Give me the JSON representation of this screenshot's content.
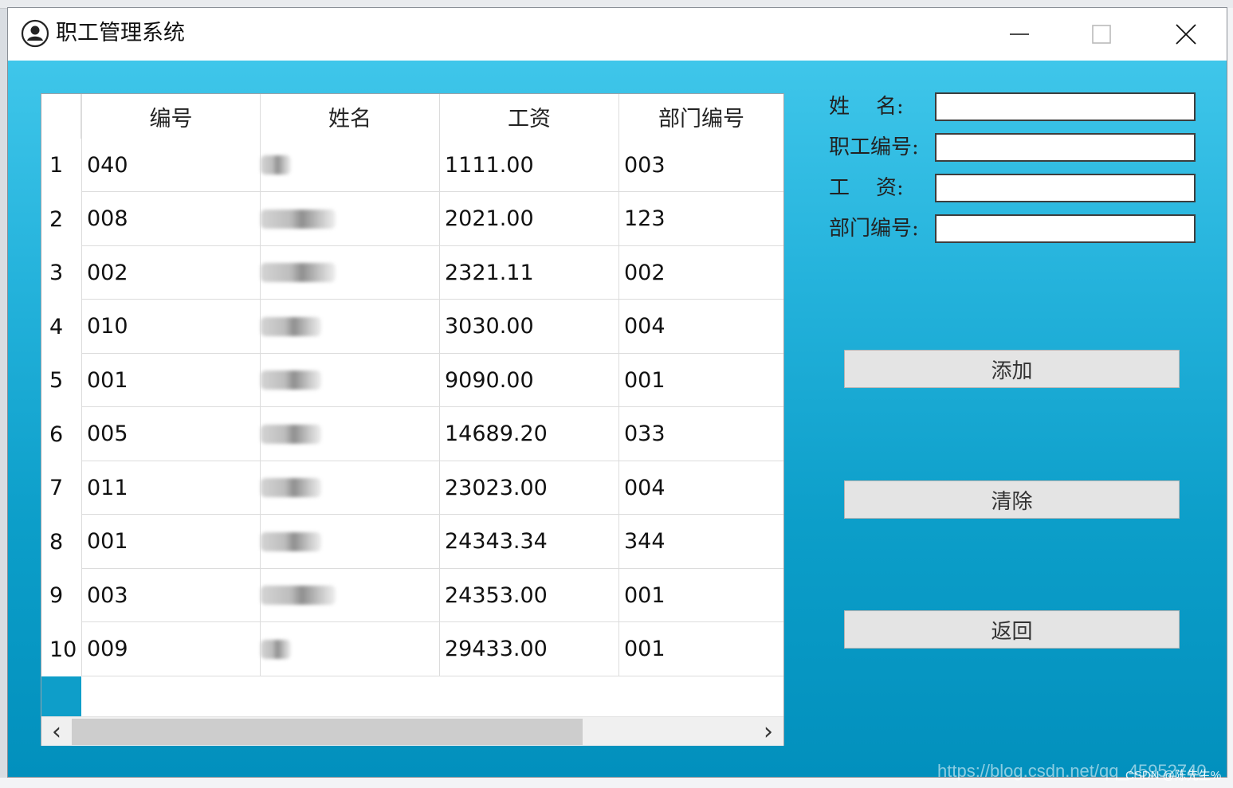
{
  "window": {
    "title": "职工管理系统",
    "icons": [
      "user-circle-icon",
      "minimize-icon",
      "maximize-icon",
      "close-icon"
    ]
  },
  "table": {
    "headers": [
      "编号",
      "姓名",
      "工资",
      "部门编号"
    ],
    "rows": [
      {
        "num": "1",
        "id": "040",
        "salary": "1111.00",
        "dept": "003"
      },
      {
        "num": "2",
        "id": "008",
        "salary": "2021.00",
        "dept": "123"
      },
      {
        "num": "3",
        "id": "002",
        "salary": "2321.11",
        "dept": "002"
      },
      {
        "num": "4",
        "id": "010",
        "salary": "3030.00",
        "dept": "004"
      },
      {
        "num": "5",
        "id": "001",
        "salary": "9090.00",
        "dept": "001"
      },
      {
        "num": "6",
        "id": "005",
        "salary": "14689.20",
        "dept": "033"
      },
      {
        "num": "7",
        "id": "011",
        "salary": "23023.00",
        "dept": "004"
      },
      {
        "num": "8",
        "id": "001",
        "salary": "24343.34",
        "dept": "344"
      },
      {
        "num": "9",
        "id": "003",
        "salary": "24353.00",
        "dept": "001"
      },
      {
        "num": "10",
        "id": "009",
        "salary": "29433.00",
        "dept": "001"
      }
    ],
    "scroll_left_glyph": "‹",
    "scroll_right_glyph": "›"
  },
  "form": {
    "name_label": "姓    名:",
    "id_label": "职工编号:",
    "salary_label": "工    资:",
    "dept_label": "部门编号:",
    "name_value": "",
    "id_value": "",
    "salary_value": "",
    "dept_value": ""
  },
  "buttons": {
    "add": "添加",
    "clear": "清除",
    "back": "返回"
  },
  "watermark": {
    "url": "https://blog.csdn.net/qq_45952740",
    "csdn": "CSDN @陈先生%"
  },
  "colors": {
    "gradient_top": "#3fc6ea",
    "gradient_bottom": "#0290bd",
    "button_bg": "#e4e4e4"
  }
}
